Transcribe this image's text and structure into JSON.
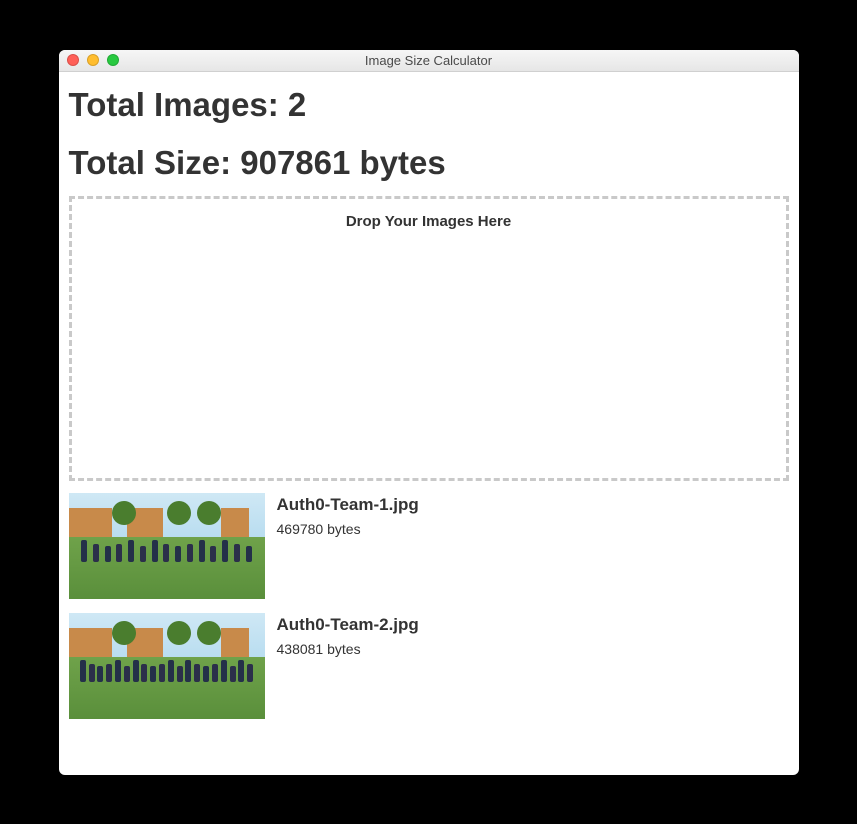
{
  "window": {
    "title": "Image Size Calculator"
  },
  "totals": {
    "images_label": "Total Images: 2",
    "size_label": "Total Size: 907861 bytes"
  },
  "dropzone": {
    "label": "Drop Your Images Here"
  },
  "items": [
    {
      "filename": "Auth0-Team-1.jpg",
      "size": "469780 bytes"
    },
    {
      "filename": "Auth0-Team-2.jpg",
      "size": "438081 bytes"
    }
  ]
}
